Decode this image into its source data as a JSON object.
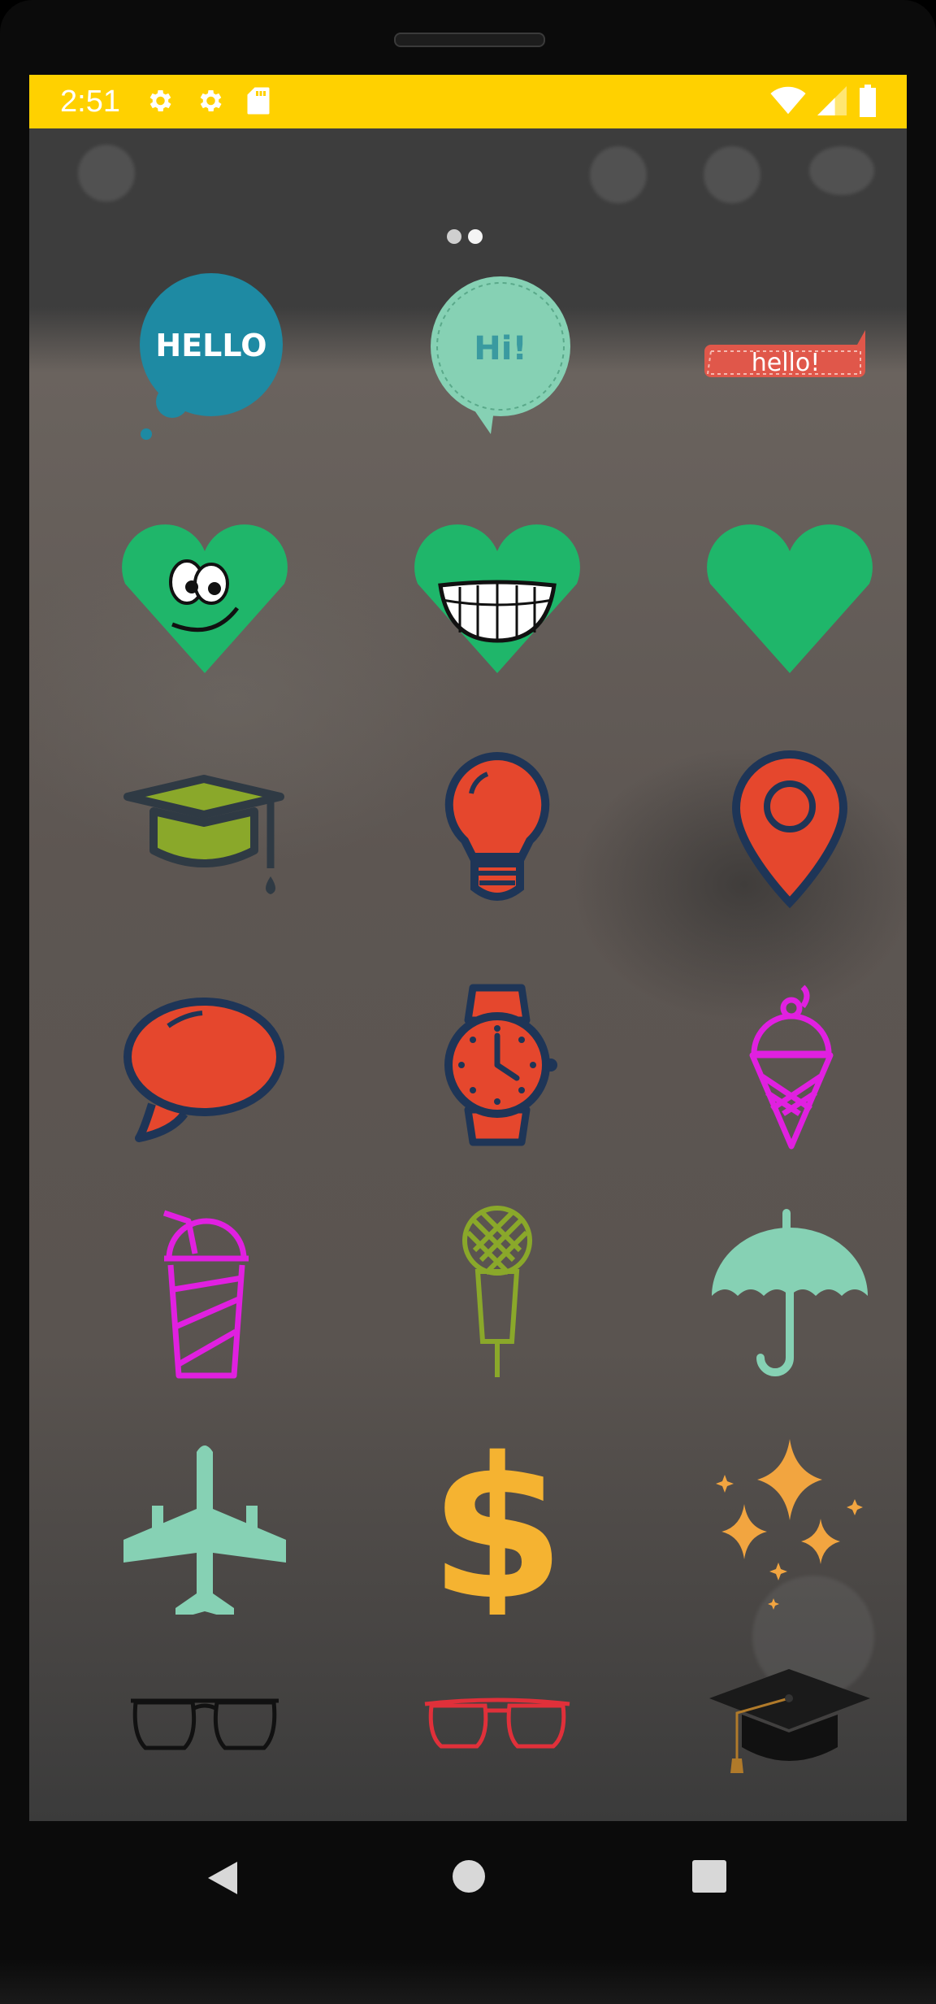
{
  "status_bar": {
    "time": "2:51",
    "left_icons": [
      "settings-icon",
      "settings-icon",
      "sd-card-icon"
    ],
    "right_icons": [
      "wifi-icon",
      "signal-icon",
      "battery-icon"
    ],
    "background": "#FFD100"
  },
  "pager": {
    "pages": 2,
    "current_page": 2
  },
  "stickers": [
    {
      "name": "hello-bubble-sticker",
      "text": "HELLO"
    },
    {
      "name": "hi-bubble-sticker",
      "text": "Hi!"
    },
    {
      "name": "hello-label-sticker",
      "text": "hello!"
    },
    {
      "name": "heart-cartoon-eyes-sticker"
    },
    {
      "name": "heart-grin-sticker"
    },
    {
      "name": "heart-sticker"
    },
    {
      "name": "graduation-cap-sticker"
    },
    {
      "name": "light-bulb-sticker"
    },
    {
      "name": "map-pin-sticker"
    },
    {
      "name": "speech-bubble-sticker"
    },
    {
      "name": "wristwatch-sticker"
    },
    {
      "name": "ice-cream-cone-sticker"
    },
    {
      "name": "drink-cup-sticker"
    },
    {
      "name": "microphone-sticker"
    },
    {
      "name": "umbrella-sticker"
    },
    {
      "name": "airplane-sticker"
    },
    {
      "name": "dollar-sign-sticker",
      "text": "$"
    },
    {
      "name": "sparkles-sticker"
    },
    {
      "name": "black-glasses-sticker"
    },
    {
      "name": "red-glasses-sticker"
    },
    {
      "name": "mortarboard-sticker"
    }
  ],
  "colors": {
    "teal": "#1E8AA3",
    "mint": "#86D1B4",
    "coral": "#E0574A",
    "green": "#1FB66A",
    "navy": "#1E3557",
    "orange_red": "#E5472D",
    "magenta": "#E020E0",
    "olive": "#8AA82A",
    "gold": "#F5B331",
    "amber": "#F2A540"
  },
  "nav_bar": {
    "back": "back-icon",
    "home": "home-icon",
    "recents": "recents-icon"
  }
}
